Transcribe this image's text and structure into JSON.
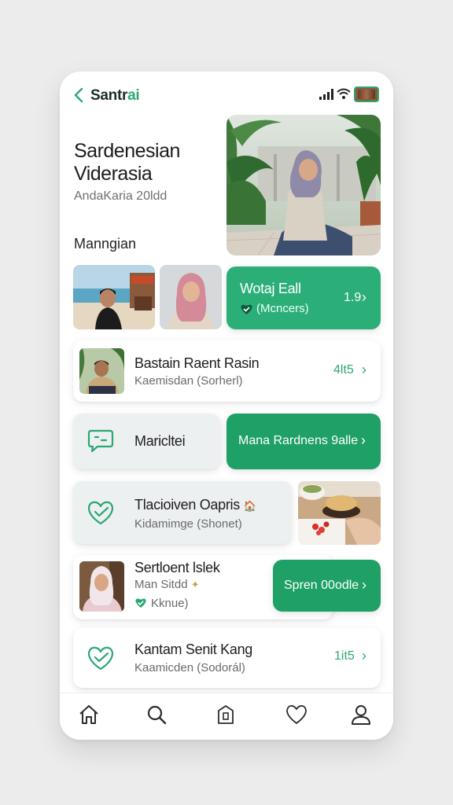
{
  "header": {
    "app_name_main": "Santr",
    "app_name_accent": "ai",
    "icons": [
      "back-chevron-icon",
      "signal-icon",
      "wifi-icon",
      "battery-icon"
    ]
  },
  "hero": {
    "title": "Sardenesian Viderasia",
    "subtitle": "AndaKaria 20ldd"
  },
  "section": {
    "label": "Manngian"
  },
  "highlight": {
    "title": "Wotaj Eall",
    "subtitle": "(Mcncers)",
    "count": "1.9",
    "chevron": "›"
  },
  "list": [
    {
      "title": "Bastain Raent Rasin",
      "subtitle": "Kaemisdan (Sorherl)",
      "count": "4lt5",
      "chevron": "›"
    },
    {
      "title": "Maricltei",
      "action": "Mana Rardnens 9alle",
      "chevron": "›"
    },
    {
      "title": "Tlacioiven Oapris",
      "badge": "🏠",
      "subtitle": "Kidamimge (Shonet)"
    },
    {
      "title": "Sertloent lslek",
      "subtitle": "Man Sitdd",
      "meta": "Kknue)",
      "action": "Spren 00odle",
      "chevron": "›"
    },
    {
      "title": "Kantam Senit Kang",
      "subtitle": "Kaamicden (Sodorál)",
      "count": "1it5",
      "chevron": "›"
    }
  ],
  "tabs": [
    {
      "icon": "home-icon"
    },
    {
      "icon": "search-icon"
    },
    {
      "icon": "bookmark-icon"
    },
    {
      "icon": "heart-icon"
    },
    {
      "icon": "profile-icon"
    }
  ],
  "colors": {
    "accent": "#2aa872",
    "accent_dark": "#1fa066",
    "card_gray": "#edf0f1",
    "background": "#ececec"
  }
}
